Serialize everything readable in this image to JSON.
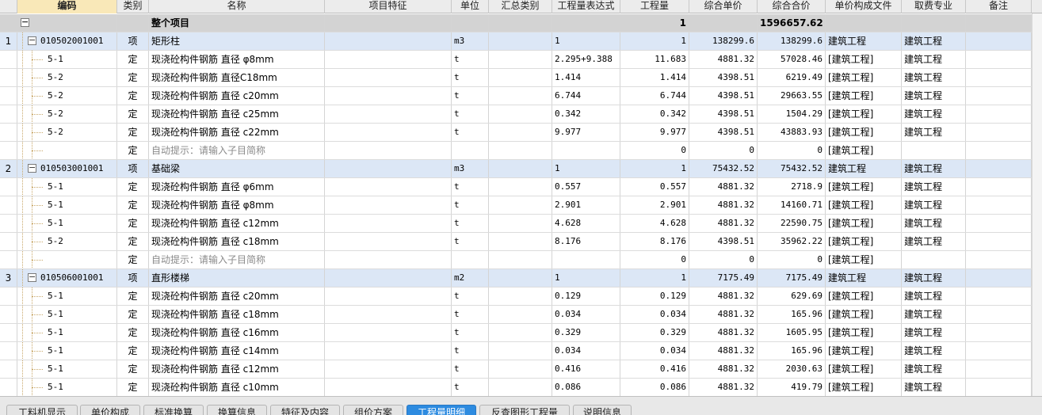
{
  "columns": [
    {
      "key": "idx",
      "label": ""
    },
    {
      "key": "code",
      "label": "编码"
    },
    {
      "key": "type",
      "label": "类别"
    },
    {
      "key": "name",
      "label": "名称"
    },
    {
      "key": "feature",
      "label": "项目特征"
    },
    {
      "key": "unit",
      "label": "单位"
    },
    {
      "key": "summary",
      "label": "汇总类别"
    },
    {
      "key": "expr",
      "label": "工程量表达式"
    },
    {
      "key": "qty",
      "label": "工程量"
    },
    {
      "key": "uprice",
      "label": "综合单价"
    },
    {
      "key": "total",
      "label": "综合合价"
    },
    {
      "key": "file",
      "label": "单价构成文件"
    },
    {
      "key": "major",
      "label": "取费专业"
    },
    {
      "key": "note",
      "label": "备注"
    }
  ],
  "rows": [
    {
      "kind": "total",
      "idx": "",
      "code": "",
      "type": "",
      "name": "整个项目",
      "feature": "",
      "unit": "",
      "summary": "",
      "expr": "",
      "qty": "1",
      "uprice": "",
      "total": "1596657.62",
      "file": "",
      "major": "",
      "note": ""
    },
    {
      "kind": "parent",
      "idx": "1",
      "code": "010502001001",
      "type": "项",
      "name": "矩形柱",
      "feature": "",
      "unit": "m3",
      "summary": "",
      "expr": "1",
      "qty": "1",
      "uprice": "138299.6",
      "total": "138299.6",
      "file": "建筑工程",
      "major": "建筑工程",
      "note": ""
    },
    {
      "kind": "child",
      "idx": "",
      "code": "5-1",
      "type": "定",
      "name": "现浇砼构件钢筋 直径 φ8mm",
      "feature": "",
      "unit": "t",
      "summary": "",
      "expr": "2.295+9.388",
      "qty": "11.683",
      "uprice": "4881.32",
      "total": "57028.46",
      "file": "[建筑工程]",
      "major": "建筑工程",
      "note": ""
    },
    {
      "kind": "child",
      "idx": "",
      "code": "5-2",
      "type": "定",
      "name": "现浇砼构件钢筋 直径C18mm",
      "feature": "",
      "unit": "t",
      "summary": "",
      "expr": "1.414",
      "qty": "1.414",
      "uprice": "4398.51",
      "total": "6219.49",
      "file": "[建筑工程]",
      "major": "建筑工程",
      "note": ""
    },
    {
      "kind": "child",
      "idx": "",
      "code": "5-2",
      "type": "定",
      "name": "现浇砼构件钢筋 直径 c20mm",
      "feature": "",
      "unit": "t",
      "summary": "",
      "expr": "6.744",
      "qty": "6.744",
      "uprice": "4398.51",
      "total": "29663.55",
      "file": "[建筑工程]",
      "major": "建筑工程",
      "note": ""
    },
    {
      "kind": "child",
      "idx": "",
      "code": "5-2",
      "type": "定",
      "name": "现浇砼构件钢筋 直径 c25mm",
      "feature": "",
      "unit": "t",
      "summary": "",
      "expr": "0.342",
      "qty": "0.342",
      "uprice": "4398.51",
      "total": "1504.29",
      "file": "[建筑工程]",
      "major": "建筑工程",
      "note": ""
    },
    {
      "kind": "child",
      "idx": "",
      "code": "5-2",
      "type": "定",
      "name": "现浇砼构件钢筋 直径 c22mm",
      "feature": "",
      "unit": "t",
      "summary": "",
      "expr": "9.977",
      "qty": "9.977",
      "uprice": "4398.51",
      "total": "43883.93",
      "file": "[建筑工程]",
      "major": "建筑工程",
      "note": ""
    },
    {
      "kind": "child",
      "placeholder": true,
      "idx": "",
      "code": "",
      "type": "定",
      "name": "自动提示：请输入子目简称",
      "feature": "",
      "unit": "",
      "summary": "",
      "expr": "",
      "qty": "0",
      "uprice": "0",
      "total": "0",
      "file": "[建筑工程]",
      "major": "",
      "note": ""
    },
    {
      "kind": "parent",
      "idx": "2",
      "code": "010503001001",
      "type": "项",
      "name": "基础梁",
      "feature": "",
      "unit": "m3",
      "summary": "",
      "expr": "1",
      "qty": "1",
      "uprice": "75432.52",
      "total": "75432.52",
      "file": "建筑工程",
      "major": "建筑工程",
      "note": ""
    },
    {
      "kind": "child",
      "idx": "",
      "code": "5-1",
      "type": "定",
      "name": "现浇砼构件钢筋 直径 φ6mm",
      "feature": "",
      "unit": "t",
      "summary": "",
      "expr": "0.557",
      "qty": "0.557",
      "uprice": "4881.32",
      "total": "2718.9",
      "file": "[建筑工程]",
      "major": "建筑工程",
      "note": ""
    },
    {
      "kind": "child",
      "idx": "",
      "code": "5-1",
      "type": "定",
      "name": "现浇砼构件钢筋 直径 φ8mm",
      "feature": "",
      "unit": "t",
      "summary": "",
      "expr": "2.901",
      "qty": "2.901",
      "uprice": "4881.32",
      "total": "14160.71",
      "file": "[建筑工程]",
      "major": "建筑工程",
      "note": ""
    },
    {
      "kind": "child",
      "idx": "",
      "code": "5-1",
      "type": "定",
      "name": "现浇砼构件钢筋 直径 c12mm",
      "feature": "",
      "unit": "t",
      "summary": "",
      "expr": "4.628",
      "qty": "4.628",
      "uprice": "4881.32",
      "total": "22590.75",
      "file": "[建筑工程]",
      "major": "建筑工程",
      "note": ""
    },
    {
      "kind": "child",
      "idx": "",
      "code": "5-2",
      "type": "定",
      "name": "现浇砼构件钢筋 直径 c18mm",
      "feature": "",
      "unit": "t",
      "summary": "",
      "expr": "8.176",
      "qty": "8.176",
      "uprice": "4398.51",
      "total": "35962.22",
      "file": "[建筑工程]",
      "major": "建筑工程",
      "note": ""
    },
    {
      "kind": "child",
      "placeholder": true,
      "idx": "",
      "code": "",
      "type": "定",
      "name": "自动提示：请输入子目简称",
      "feature": "",
      "unit": "",
      "summary": "",
      "expr": "",
      "qty": "0",
      "uprice": "0",
      "total": "0",
      "file": "[建筑工程]",
      "major": "",
      "note": ""
    },
    {
      "kind": "parent",
      "idx": "3",
      "code": "010506001001",
      "type": "项",
      "name": "直形楼梯",
      "feature": "",
      "unit": "m2",
      "summary": "",
      "expr": "1",
      "qty": "1",
      "uprice": "7175.49",
      "total": "7175.49",
      "file": "建筑工程",
      "major": "建筑工程",
      "note": ""
    },
    {
      "kind": "child",
      "idx": "",
      "code": "5-1",
      "type": "定",
      "name": "现浇砼构件钢筋 直径 c20mm",
      "feature": "",
      "unit": "t",
      "summary": "",
      "expr": "0.129",
      "qty": "0.129",
      "uprice": "4881.32",
      "total": "629.69",
      "file": "[建筑工程]",
      "major": "建筑工程",
      "note": ""
    },
    {
      "kind": "child",
      "idx": "",
      "code": "5-1",
      "type": "定",
      "name": "现浇砼构件钢筋 直径 c18mm",
      "feature": "",
      "unit": "t",
      "summary": "",
      "expr": "0.034",
      "qty": "0.034",
      "uprice": "4881.32",
      "total": "165.96",
      "file": "[建筑工程]",
      "major": "建筑工程",
      "note": ""
    },
    {
      "kind": "child",
      "idx": "",
      "code": "5-1",
      "type": "定",
      "name": "现浇砼构件钢筋 直径 c16mm",
      "feature": "",
      "unit": "t",
      "summary": "",
      "expr": "0.329",
      "qty": "0.329",
      "uprice": "4881.32",
      "total": "1605.95",
      "file": "[建筑工程]",
      "major": "建筑工程",
      "note": ""
    },
    {
      "kind": "child",
      "idx": "",
      "code": "5-1",
      "type": "定",
      "name": "现浇砼构件钢筋 直径 c14mm",
      "feature": "",
      "unit": "t",
      "summary": "",
      "expr": "0.034",
      "qty": "0.034",
      "uprice": "4881.32",
      "total": "165.96",
      "file": "[建筑工程]",
      "major": "建筑工程",
      "note": ""
    },
    {
      "kind": "child",
      "idx": "",
      "code": "5-1",
      "type": "定",
      "name": "现浇砼构件钢筋 直径 c12mm",
      "feature": "",
      "unit": "t",
      "summary": "",
      "expr": "0.416",
      "qty": "0.416",
      "uprice": "4881.32",
      "total": "2030.63",
      "file": "[建筑工程]",
      "major": "建筑工程",
      "note": ""
    },
    {
      "kind": "child",
      "idx": "",
      "code": "5-1",
      "type": "定",
      "name": "现浇砼构件钢筋 直径 c10mm",
      "feature": "",
      "unit": "t",
      "summary": "",
      "expr": "0.086",
      "qty": "0.086",
      "uprice": "4881.32",
      "total": "419.79",
      "file": "[建筑工程]",
      "major": "建筑工程",
      "note": ""
    }
  ],
  "tabs": [
    {
      "label": "工料机显示",
      "active": false
    },
    {
      "label": "单价构成",
      "active": false
    },
    {
      "label": "标准换算",
      "active": false
    },
    {
      "label": "换算信息",
      "active": false
    },
    {
      "label": "特征及内容",
      "active": false
    },
    {
      "label": "组价方案",
      "active": false
    },
    {
      "label": "工程量明细",
      "active": true
    },
    {
      "label": "反查图形工程量",
      "active": false
    },
    {
      "label": "说明信息",
      "active": false
    }
  ],
  "colors": {
    "total_row": "#d3d3d3",
    "parent_row": "#dce7f6",
    "selected_header": "#f9e8b8",
    "active_tab": "#2d8be0"
  },
  "icons": {
    "collapse": "minus-box-icon"
  }
}
